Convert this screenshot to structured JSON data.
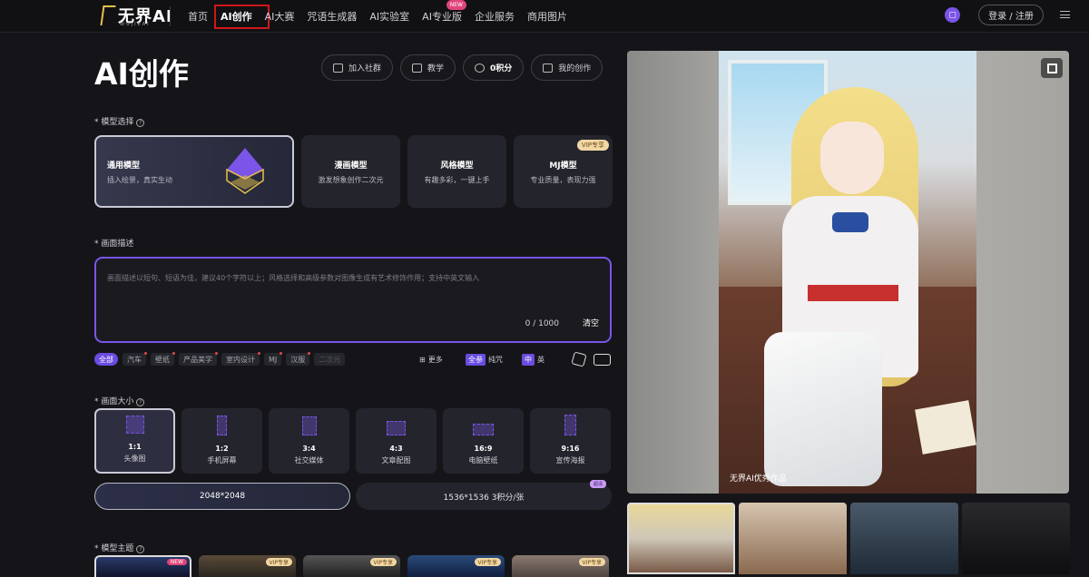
{
  "header": {
    "logo": "无界AI",
    "logo_sub": "WUJIEAI",
    "nav": [
      {
        "label": "首页",
        "active": false
      },
      {
        "label": "AI创作",
        "active": true
      },
      {
        "label": "AI大赛",
        "active": false
      },
      {
        "label": "咒语生成器",
        "active": false
      },
      {
        "label": "AI实验室",
        "active": false
      },
      {
        "label": "AI专业版",
        "active": false,
        "badge": "NEW"
      },
      {
        "label": "企业服务",
        "active": false
      },
      {
        "label": "商用图片",
        "active": false
      }
    ],
    "login_label": "登录 / 注册"
  },
  "main": {
    "title": "AI创作",
    "actions": [
      {
        "label": "加入社群",
        "icon": "community-icon"
      },
      {
        "label": "教学",
        "icon": "book-icon"
      },
      {
        "label": "0积分",
        "icon": "points-icon"
      },
      {
        "label": "我的创作",
        "icon": "folder-icon"
      }
    ]
  },
  "model_section": {
    "label": "* 模型选择",
    "models": [
      {
        "title": "通用模型",
        "desc": "插入绘景，真实生动",
        "active": true
      },
      {
        "title": "漫画模型",
        "desc": "激发想象创作二次元",
        "active": false
      },
      {
        "title": "风格模型",
        "desc": "有趣多彩，一键上手",
        "active": false
      },
      {
        "title": "MJ模型",
        "desc": "专业质量，表现力强",
        "active": false,
        "tag": "VIP专享"
      }
    ]
  },
  "desc_section": {
    "label": "* 画面描述",
    "placeholder": "画面描述以短句、短语为佳，建议40个字符以上；风格选择和高级参数对图像生成有艺术修饰作用；支持中英文输入",
    "count": "0 / 1000",
    "clear_label": "清空",
    "tags": [
      "全部",
      "汽车",
      "壁纸",
      "产品美学",
      "室内设计",
      "MJ",
      "汉服",
      "二次元"
    ],
    "more_label": "更多",
    "pure_prefix": "全参",
    "pure_label": "纯咒",
    "lang_zh": "中",
    "lang_en": "英"
  },
  "size_section": {
    "label": "* 画面大小",
    "sizes": [
      {
        "ratio": "1:1",
        "name": "头像图",
        "active": true
      },
      {
        "ratio": "1:2",
        "name": "手机屏幕",
        "active": false
      },
      {
        "ratio": "3:4",
        "name": "社交媒体",
        "active": false
      },
      {
        "ratio": "4:3",
        "name": "文章配图",
        "active": false
      },
      {
        "ratio": "16:9",
        "name": "电脑壁纸",
        "active": false
      },
      {
        "ratio": "9:16",
        "name": "宣传海报",
        "active": false
      }
    ],
    "resolutions": [
      {
        "label": "2048*2048",
        "active": true
      },
      {
        "label": "1536*1536 3积分/张",
        "active": false,
        "badge": "超清"
      }
    ]
  },
  "theme_section": {
    "label": "* 模型主题",
    "tags": [
      "NEW",
      "VIP专享",
      "VIP专享",
      "VIP专享",
      "VIP专享"
    ]
  },
  "preview": {
    "caption": "无界AI优秀作品"
  },
  "colors": {
    "accent": "#7b55e8",
    "background": "#151519",
    "highlight_box": "#d01818"
  }
}
